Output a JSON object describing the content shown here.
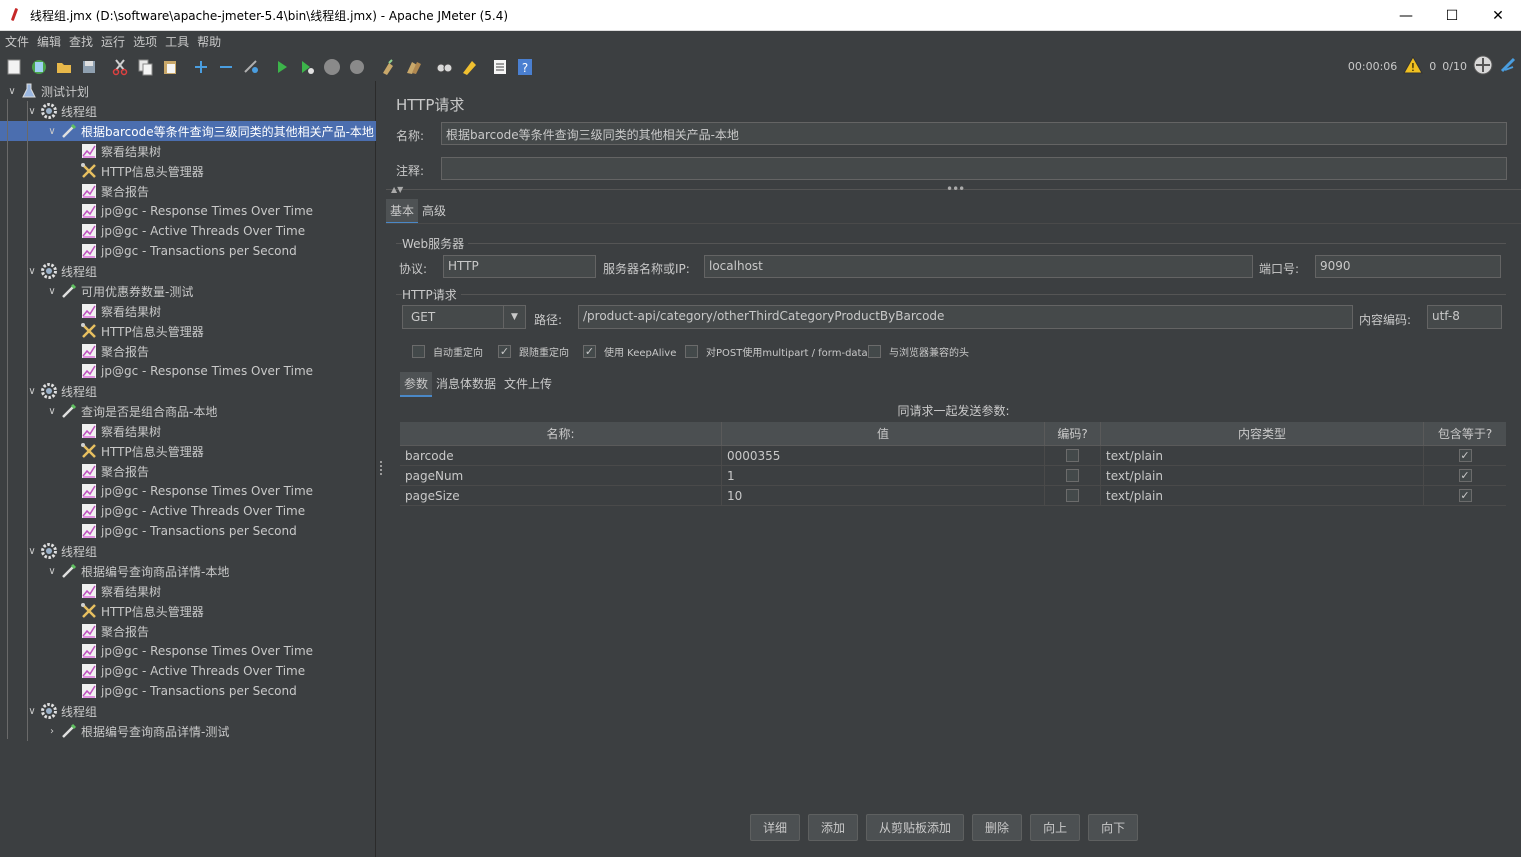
{
  "window": {
    "title": "线程组.jmx (D:\\software\\apache-jmeter-5.4\\bin\\线程组.jmx) - Apache JMeter (5.4)",
    "minimize": "—",
    "maximize": "☐",
    "close": "✕"
  },
  "menu": [
    "文件",
    "编辑",
    "查找",
    "运行",
    "选项",
    "工具",
    "帮助"
  ],
  "status": {
    "timer": "00:00:06",
    "warnings": "0",
    "threads": "0/10"
  },
  "tree": {
    "root": "测试计划",
    "groups": [
      {
        "label": "线程组",
        "sampler": "根据barcode等条件查询三级同类的其他相关产品-本地",
        "children": [
          "察看结果树",
          "HTTP信息头管理器",
          "聚合报告",
          "jp@gc - Response Times Over Time",
          "jp@gc - Active Threads Over Time",
          "jp@gc - Transactions per Second"
        ]
      },
      {
        "label": "线程组",
        "sampler": "可用优惠券数量-测试",
        "children": [
          "察看结果树",
          "HTTP信息头管理器",
          "聚合报告",
          "jp@gc - Response Times Over Time"
        ]
      },
      {
        "label": "线程组",
        "sampler": "查询是否是组合商品-本地",
        "children": [
          "察看结果树",
          "HTTP信息头管理器",
          "聚合报告",
          "jp@gc - Response Times Over Time",
          "jp@gc - Active Threads Over Time",
          "jp@gc - Transactions per Second"
        ]
      },
      {
        "label": "线程组",
        "sampler": "根据编号查询商品详情-本地",
        "children": [
          "察看结果树",
          "HTTP信息头管理器",
          "聚合报告",
          "jp@gc - Response Times Over Time",
          "jp@gc - Active Threads Over Time",
          "jp@gc - Transactions per Second"
        ]
      },
      {
        "label": "线程组",
        "sampler": "根据编号查询商品详情-测试",
        "children": []
      }
    ]
  },
  "panel": {
    "title": "HTTP请求",
    "name_label": "名称:",
    "name_value": "根据barcode等条件查询三级同类的其他相关产品-本地",
    "comment_label": "注释:",
    "comment_value": "",
    "tabs": [
      "基本",
      "高级"
    ],
    "web_server": {
      "title": "Web服务器",
      "protocol_label": "协议:",
      "protocol_value": "HTTP",
      "server_label": "服务器名称或IP:",
      "server_value": "localhost",
      "port_label": "端口号:",
      "port_value": "9090"
    },
    "http_request": {
      "title": "HTTP请求",
      "method": "GET",
      "path_label": "路径:",
      "path_value": "/product-api/category/otherThirdCategoryProductByBarcode",
      "encoding_label": "内容编码:",
      "encoding_value": "utf-8"
    },
    "options": [
      {
        "label": "自动重定向",
        "checked": false
      },
      {
        "label": "跟随重定向",
        "checked": true
      },
      {
        "label": "使用 KeepAlive",
        "checked": true
      },
      {
        "label": "对POST使用multipart / form-data",
        "checked": false
      },
      {
        "label": "与浏览器兼容的头",
        "checked": false
      }
    ],
    "subtabs": [
      "参数",
      "消息体数据",
      "文件上传"
    ],
    "params_caption": "同请求一起发送参数:",
    "columns": [
      "名称:",
      "值",
      "编码?",
      "内容类型",
      "包含等于?"
    ],
    "rows": [
      {
        "name": "barcode",
        "value": "0000355",
        "encode": false,
        "type": "text/plain",
        "include_equals": true
      },
      {
        "name": "pageNum",
        "value": "1",
        "encode": false,
        "type": "text/plain",
        "include_equals": true
      },
      {
        "name": "pageSize",
        "value": "10",
        "encode": false,
        "type": "text/plain",
        "include_equals": true
      }
    ],
    "buttons": [
      "详细",
      "添加",
      "从剪贴板添加",
      "删除",
      "向上",
      "向下"
    ]
  }
}
